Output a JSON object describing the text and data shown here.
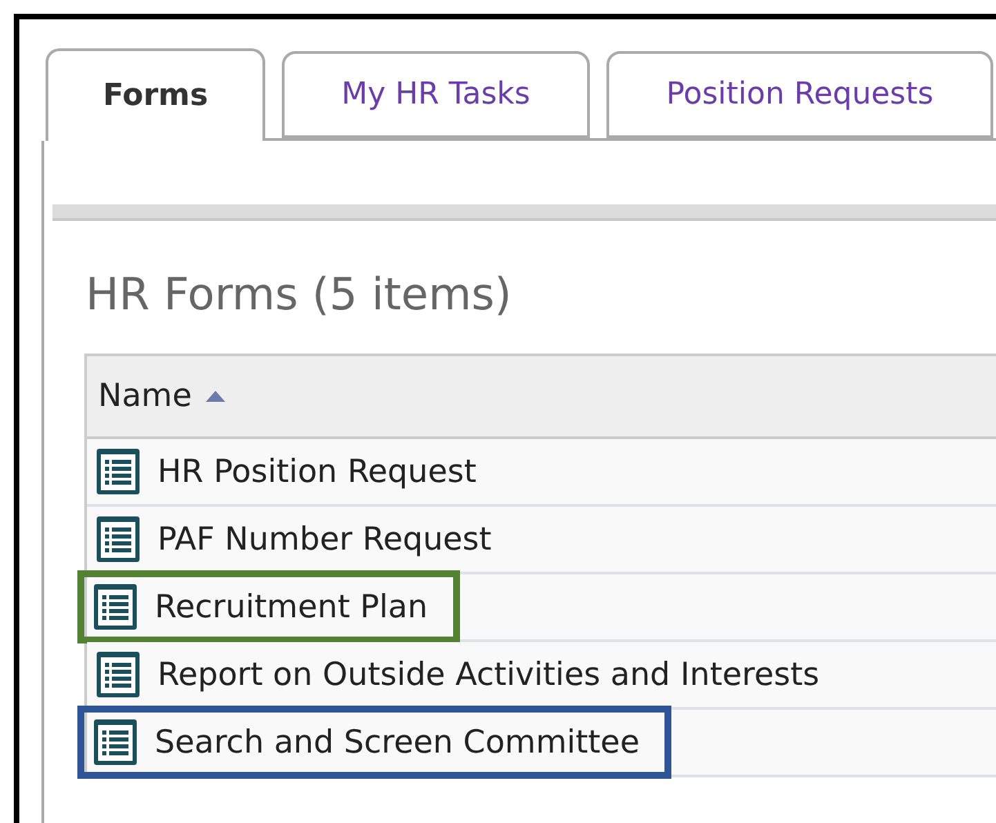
{
  "tabs": [
    {
      "label": "Forms",
      "selected": true
    },
    {
      "label": "My HR Tasks",
      "selected": false
    },
    {
      "label": "Position Requests",
      "selected": false
    }
  ],
  "heading": "HR Forms (5 items)",
  "table": {
    "columns": [
      {
        "label": "Name",
        "sorted_ascending": true
      }
    ],
    "rows": [
      {
        "name": "HR Position Request"
      },
      {
        "name": "PAF Number Request"
      },
      {
        "name": "Recruitment Plan",
        "color": "#548235"
      },
      {
        "name": "Report on Outside Activities and Interests"
      },
      {
        "name": "Search and Screen Committee",
        "color": "#2f5597"
      }
    ]
  }
}
